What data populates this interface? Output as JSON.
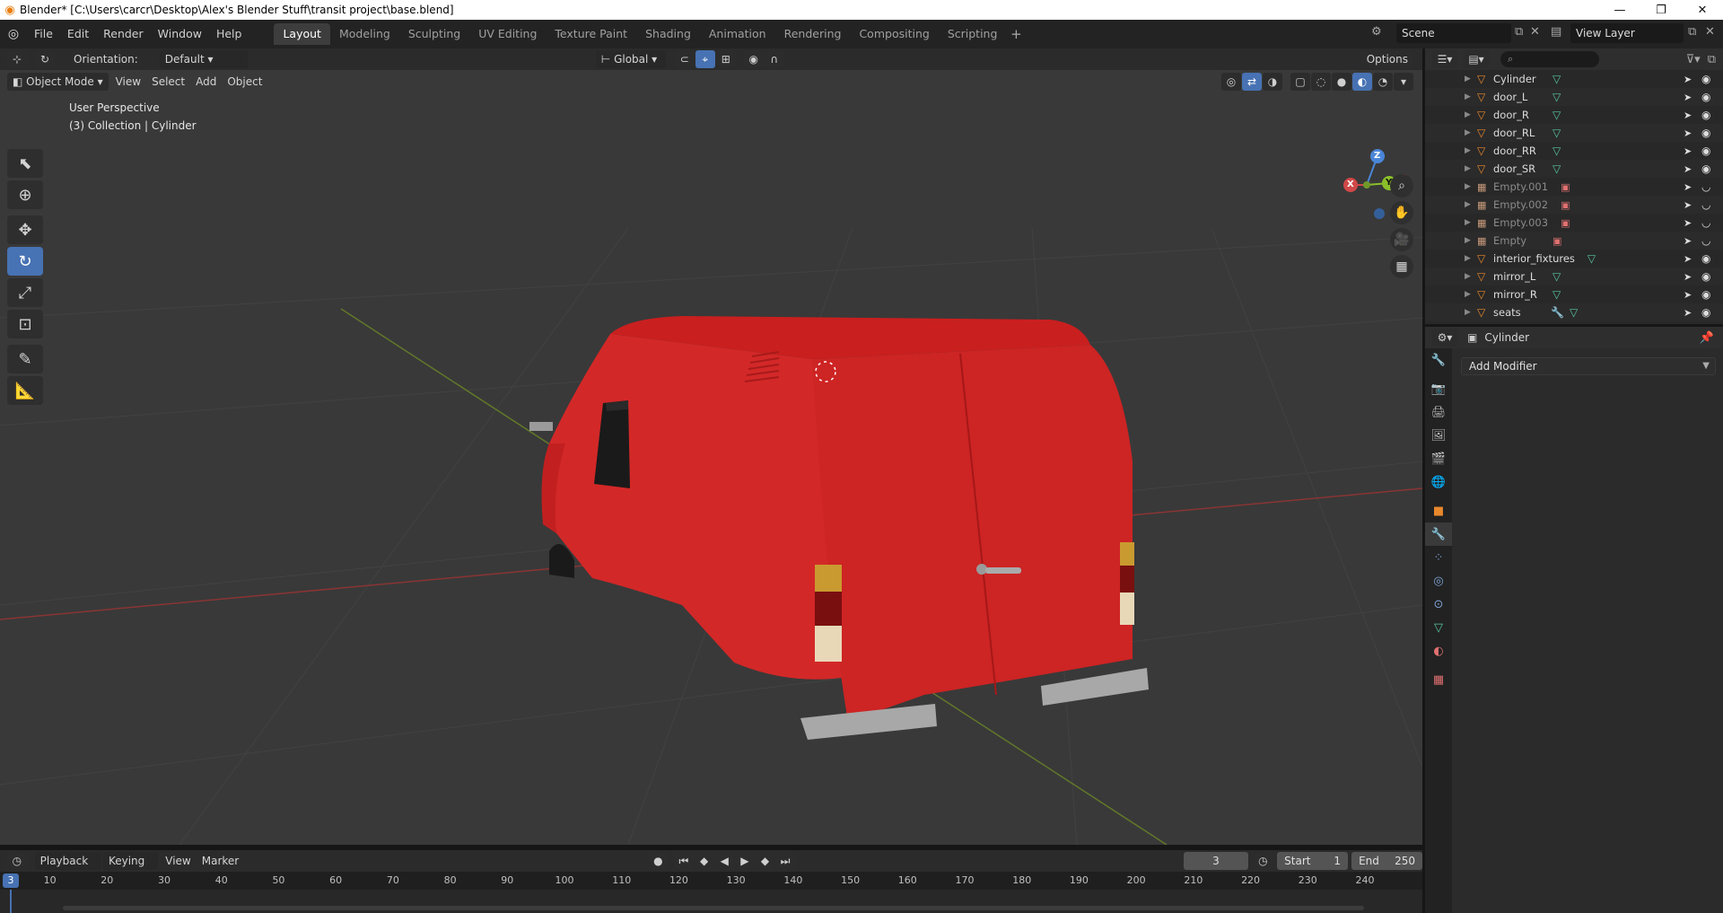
{
  "window": {
    "title": "Blender* [C:\\Users\\carcr\\Desktop\\Alex's Blender Stuff\\transit project\\base.blend]",
    "minimize": "—",
    "maximize": "❐",
    "close": "✕"
  },
  "menu": [
    "File",
    "Edit",
    "Render",
    "Window",
    "Help"
  ],
  "workspaces": [
    "Layout",
    "Modeling",
    "Sculpting",
    "UV Editing",
    "Texture Paint",
    "Shading",
    "Animation",
    "Rendering",
    "Compositing",
    "Scripting"
  ],
  "workspace_add": "+",
  "scene": {
    "name": "Scene",
    "view_layer": "View Layer"
  },
  "viewport": {
    "orientation_label": "Orientation:",
    "orientation_value": "Default",
    "transform_orientation": "Global",
    "options_label": "Options",
    "mode": "Object Mode",
    "menus": [
      "View",
      "Select",
      "Add",
      "Object"
    ],
    "info_line1": "User Perspective",
    "info_line2": "(3) Collection | Cylinder",
    "gizmo": {
      "x": "X",
      "y": "Y",
      "z": "Z"
    }
  },
  "timeline": {
    "menus": [
      "Playback",
      "Keying",
      "View",
      "Marker"
    ],
    "current_frame": "3",
    "start_label": "Start",
    "start_value": "1",
    "end_label": "End",
    "end_value": "250",
    "ticks": [
      "10",
      "20",
      "30",
      "40",
      "50",
      "60",
      "70",
      "80",
      "90",
      "100",
      "110",
      "120",
      "130",
      "140",
      "150",
      "160",
      "170",
      "180",
      "190",
      "200",
      "210",
      "220",
      "230",
      "240"
    ],
    "playhead": "3"
  },
  "outliner": {
    "search_placeholder": "",
    "items": [
      {
        "name": "Cylinder",
        "type": "mesh"
      },
      {
        "name": "door_L",
        "type": "mesh"
      },
      {
        "name": "door_R",
        "type": "mesh"
      },
      {
        "name": "door_RL",
        "type": "mesh"
      },
      {
        "name": "door_RR",
        "type": "mesh"
      },
      {
        "name": "door_SR",
        "type": "mesh"
      },
      {
        "name": "Empty.001",
        "type": "empty"
      },
      {
        "name": "Empty.002",
        "type": "empty"
      },
      {
        "name": "Empty.003",
        "type": "empty"
      },
      {
        "name": "Empty",
        "type": "empty"
      },
      {
        "name": "interior_fixtures",
        "type": "mesh"
      },
      {
        "name": "mirror_L",
        "type": "mesh"
      },
      {
        "name": "mirror_R",
        "type": "mesh"
      },
      {
        "name": "seats",
        "type": "mesh"
      }
    ]
  },
  "properties": {
    "object_name": "Cylinder",
    "add_modifier": "Add Modifier"
  },
  "colors": {
    "accent": "#4772b3",
    "van_body": "#d42a2a",
    "grid_x": "#9a3a3a",
    "grid_y": "#6b8a2a"
  }
}
